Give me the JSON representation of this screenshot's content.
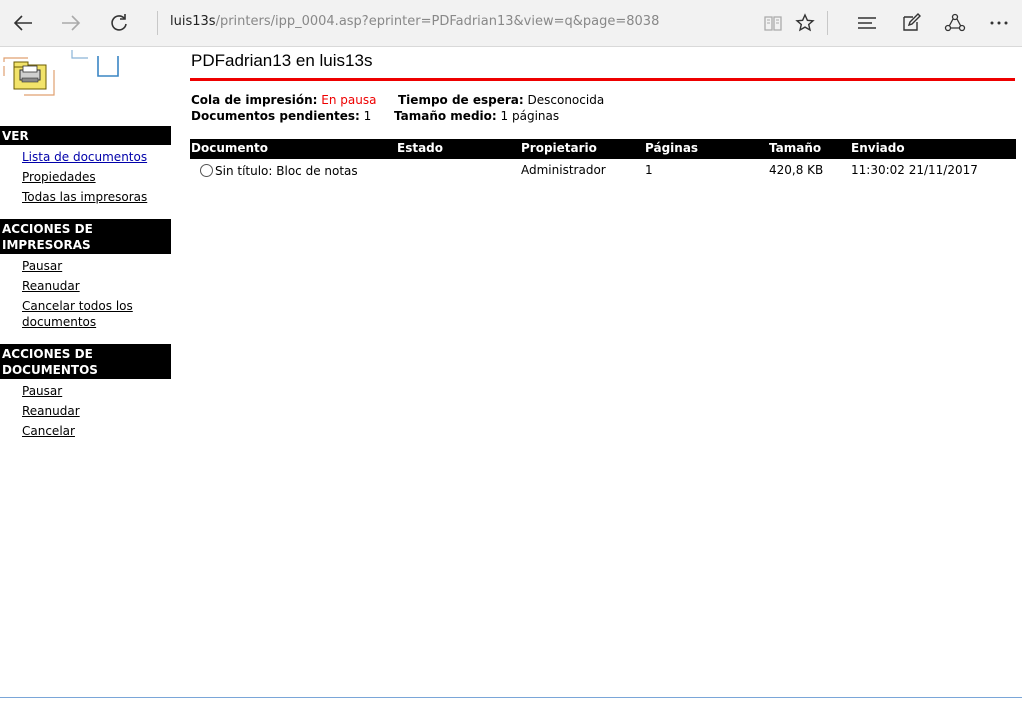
{
  "browser": {
    "address_host": "luis13s",
    "address_path": "/printers/ipp_0004.asp?eprinter=PDFadrian13&view=q&page=8038"
  },
  "sidebar": {
    "sections": [
      {
        "title": "VER",
        "links": [
          "Lista de documentos",
          "Propiedades",
          "Todas las impresoras"
        ]
      },
      {
        "title": "ACCIONES DE IMPRESORAS",
        "links": [
          "Pausar",
          "Reanudar",
          "Cancelar todos los documentos"
        ]
      },
      {
        "title": "ACCIONES DE DOCUMENTOS",
        "links": [
          "Pausar",
          "Reanudar",
          "Cancelar"
        ]
      }
    ]
  },
  "page": {
    "title": "PDFadrian13 en luis13s",
    "queue_label": "Cola de impresión:",
    "queue_value": "En pausa",
    "wait_label": "Tiempo de espera:",
    "wait_value": "Desconocida",
    "pending_label": "Documentos pendientes:",
    "pending_value": "1",
    "avg_label": "Tamaño medio:",
    "avg_value": "1 páginas"
  },
  "table": {
    "headers": [
      "Documento",
      "Estado",
      "Propietario",
      "Páginas",
      "Tamaño",
      "Enviado"
    ],
    "rows": [
      [
        "Sin título: Bloc de notas",
        "",
        "Administrador",
        "1",
        "420,8 KB",
        "11:30:02 21/11/2017"
      ]
    ]
  },
  "colors": {
    "accent_red": "#e00000",
    "link_blue": "#0000aa"
  }
}
